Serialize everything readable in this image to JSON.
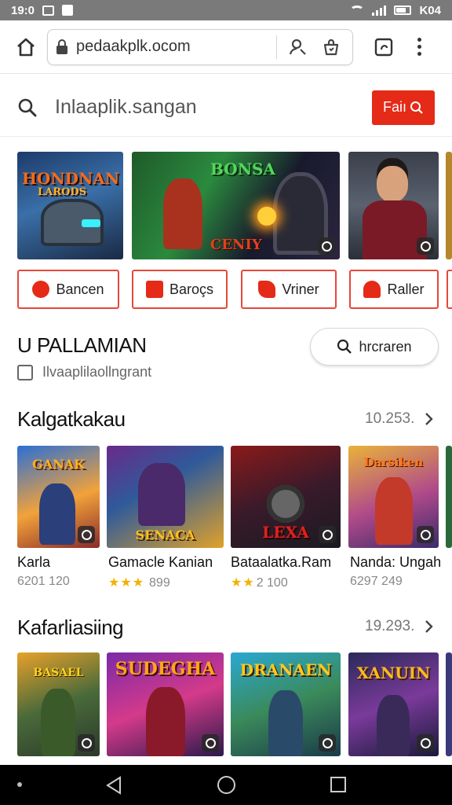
{
  "status_bar": {
    "time": "19:0",
    "right_text": "K04"
  },
  "browser": {
    "url": "pedaakplk.ocom"
  },
  "search": {
    "text": "Inlaaplik.sangan",
    "button_label": "Faiı"
  },
  "banners": [
    {
      "title": "HONDNAN",
      "subtitle": "LARODS"
    },
    {
      "title": "BONSA",
      "caption": "CENIY"
    },
    {
      "title": ""
    }
  ],
  "categories": [
    {
      "label": "Bancen"
    },
    {
      "label": "Baroçs"
    },
    {
      "label": "Vriner"
    },
    {
      "label": "Raller"
    }
  ],
  "section_main": {
    "title": "U PALLAMIAN",
    "button_label": "hrcraren",
    "subtitle": "Ilvaaplilaollngrant"
  },
  "row1": {
    "title": "Kalgatkakau",
    "count": "10.253.",
    "items": [
      {
        "title": "Karla",
        "meta": "6201 120",
        "stars": "",
        "art_text": "GANAK"
      },
      {
        "title": "Gamacle Kanian",
        "meta": "899",
        "stars": "★★★",
        "art_text": "SENACA"
      },
      {
        "title": "Bataalatka.Ram",
        "meta": "2 100",
        "stars": "★★",
        "art_text": "LEXA"
      },
      {
        "title": "Nanda: Ungah",
        "meta": "6297 249",
        "stars": "",
        "art_text": "Darsiken"
      }
    ]
  },
  "row2": {
    "title": "Kafarliasiing",
    "count": "19.293.",
    "items": [
      {
        "art_text": "BASAEL"
      },
      {
        "art_text": "SUDEGHA"
      },
      {
        "art_text": "DRANAEN"
      },
      {
        "art_text": "XANUIN"
      }
    ]
  },
  "colors": {
    "accent": "#e52a17",
    "star": "#f2b200"
  }
}
